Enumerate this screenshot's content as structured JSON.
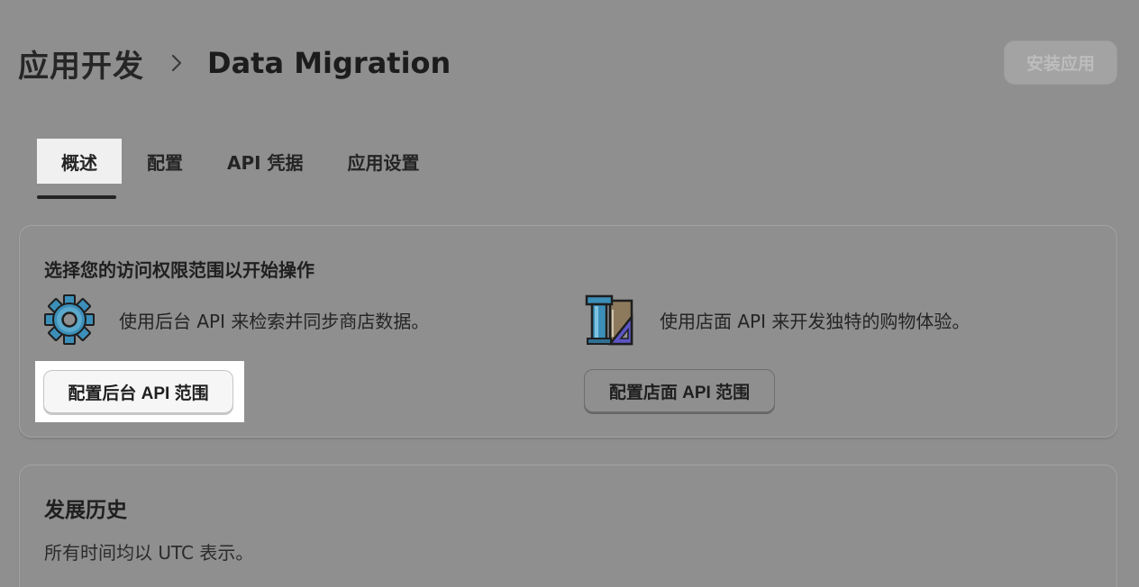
{
  "header": {
    "breadcrumb_root": "应用开发",
    "breadcrumb_current": "Data Migration",
    "install_label": "安装应用"
  },
  "tabs": [
    {
      "label": "概述",
      "active": true
    },
    {
      "label": "配置",
      "active": false
    },
    {
      "label": "API 凭据",
      "active": false
    },
    {
      "label": "应用设置",
      "active": false
    }
  ],
  "scope_card": {
    "title": "选择您的访问权限范围以开始操作",
    "admin": {
      "icon": "gear-icon",
      "description": "使用后台 API 来检索并同步商店数据。",
      "button_label": "配置后台 API 范围"
    },
    "storefront": {
      "icon": "storefront-tools-icon",
      "description": "使用店面 API 来开发独特的购物体验。",
      "button_label": "配置店面 API 范围"
    }
  },
  "history_card": {
    "title": "发展历史",
    "subtitle": "所有时间均以 UTC 表示。"
  },
  "colors": {
    "page_background": "#8f8f8f",
    "highlight": "#ffffff",
    "gear_blue": "#3c8fb8",
    "ruler_purple": "#5b55c4"
  }
}
